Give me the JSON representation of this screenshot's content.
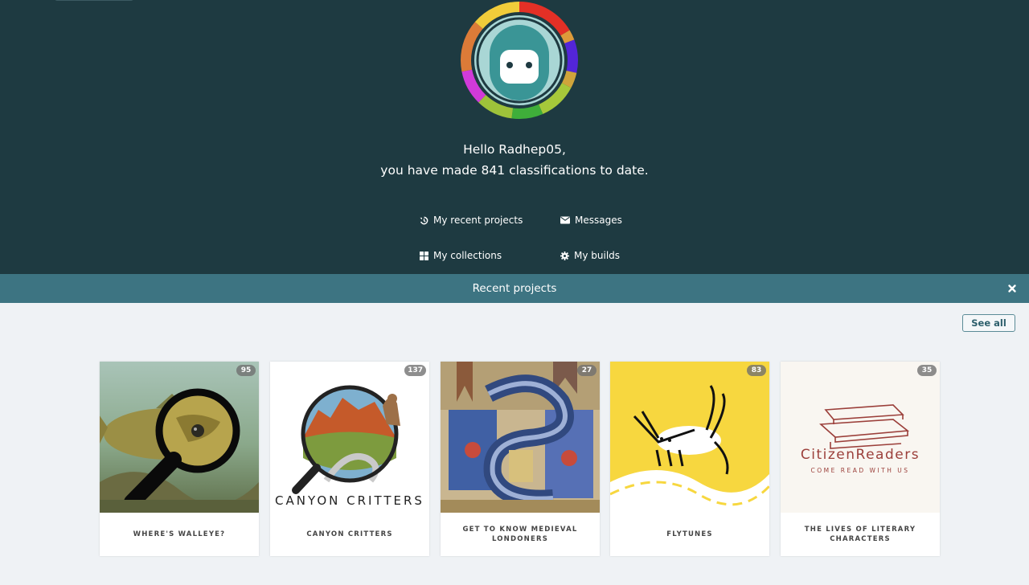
{
  "greeting": {
    "line1": "Hello Radhep05,",
    "line2": "you have made 841 classifications to date."
  },
  "nav": {
    "recent_projects": {
      "label": "My recent projects",
      "icon": "history-icon"
    },
    "messages": {
      "label": "Messages",
      "icon": "envelope-icon"
    },
    "collections": {
      "label": "My collections",
      "icon": "grid-icon"
    },
    "builds": {
      "label": "My builds",
      "icon": "gear-icon"
    }
  },
  "recent_banner": {
    "title": "Recent projects",
    "close_icon": "close-icon"
  },
  "see_all_label": "See all",
  "projects": [
    {
      "title": "WHERE'S WALLEYE?",
      "count": "95"
    },
    {
      "title": "CANYON CRITTERS",
      "count": "137",
      "logo_text": "CANYON CRITTERS"
    },
    {
      "title": "GET TO KNOW MEDIEVAL LONDONERS",
      "count": "27"
    },
    {
      "title": "FLYTUNES",
      "count": "83"
    },
    {
      "title": "THE LIVES OF LITERARY CHARACTERS",
      "count": "35",
      "logo_text": "CitizenReaders",
      "logo_tagline": "COME READ WITH US"
    }
  ],
  "colors": {
    "hero_bg": "#1e3a41",
    "banner_bg": "#3d7482",
    "page_bg": "#eff2f5"
  }
}
